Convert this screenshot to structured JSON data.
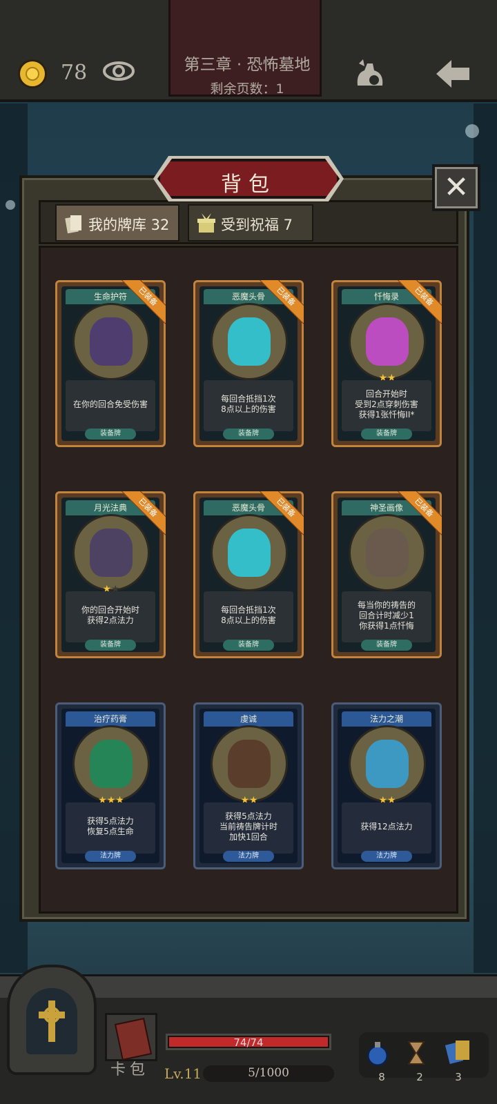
{
  "top": {
    "gold": "78",
    "chapter_title": "第三章 · 恐怖墓地",
    "remaining_pages": "剩余页数：1"
  },
  "panel": {
    "title": "背包",
    "tabs": [
      {
        "label": "我的牌库 32",
        "active": true
      },
      {
        "label": "受到祝福 7",
        "active": false
      }
    ],
    "equipped_ribbon": "已装备"
  },
  "cards": [
    {
      "name": "生命护符",
      "type": "装备牌",
      "kind": "equipment",
      "equipped": true,
      "stars": 0,
      "max_stars": 0,
      "desc": [
        "在你的回合免受伤害"
      ]
    },
    {
      "name": "恶魔头骨",
      "type": "装备牌",
      "kind": "equipment",
      "equipped": true,
      "stars": 0,
      "max_stars": 0,
      "desc": [
        "每回合抵挡1次",
        "8点以上的伤害"
      ]
    },
    {
      "name": "忏悔录",
      "type": "装备牌",
      "kind": "equipment",
      "equipped": true,
      "stars": 2,
      "max_stars": 2,
      "desc": [
        "回合开始时",
        "受到2点穿刺伤害",
        "获得1张忏悔II*"
      ]
    },
    {
      "name": "月光法典",
      "type": "装备牌",
      "kind": "equipment",
      "equipped": true,
      "stars": 1,
      "max_stars": 2,
      "desc": [
        "你的回合开始时",
        "获得2点法力"
      ]
    },
    {
      "name": "恶魔头骨",
      "type": "装备牌",
      "kind": "equipment",
      "equipped": true,
      "stars": 0,
      "max_stars": 0,
      "desc": [
        "每回合抵挡1次",
        "8点以上的伤害"
      ]
    },
    {
      "name": "神圣画像",
      "type": "装备牌",
      "kind": "equipment",
      "equipped": true,
      "stars": 0,
      "max_stars": 0,
      "desc": [
        "每当你的祷告的",
        "回合计时减少1",
        "你获得1点忏悔"
      ]
    },
    {
      "name": "治疗药膏",
      "type": "法力牌",
      "kind": "spell",
      "equipped": false,
      "stars": 3,
      "max_stars": 3,
      "desc": [
        "获得5点法力",
        "恢复5点生命"
      ]
    },
    {
      "name": "虔诚",
      "type": "法力牌",
      "kind": "spell",
      "equipped": false,
      "stars": 2,
      "max_stars": 2,
      "desc": [
        "获得5点法力",
        "当前祷告牌计时",
        "加快1回合"
      ]
    },
    {
      "name": "法力之潮",
      "type": "法力牌",
      "kind": "spell",
      "equipped": false,
      "stars": 2,
      "max_stars": 2,
      "desc": [
        "获得12点法力"
      ]
    }
  ],
  "bottom": {
    "deck_label": "卡包",
    "hp_text": "74/74",
    "hp_fraction": 1.0,
    "level": "Lv.11",
    "xp_text": "5/1000",
    "resources": [
      {
        "icon": "potion-icon",
        "count": "8"
      },
      {
        "icon": "hourglass-icon",
        "count": "2"
      },
      {
        "icon": "cards-icon",
        "count": "3"
      }
    ]
  }
}
